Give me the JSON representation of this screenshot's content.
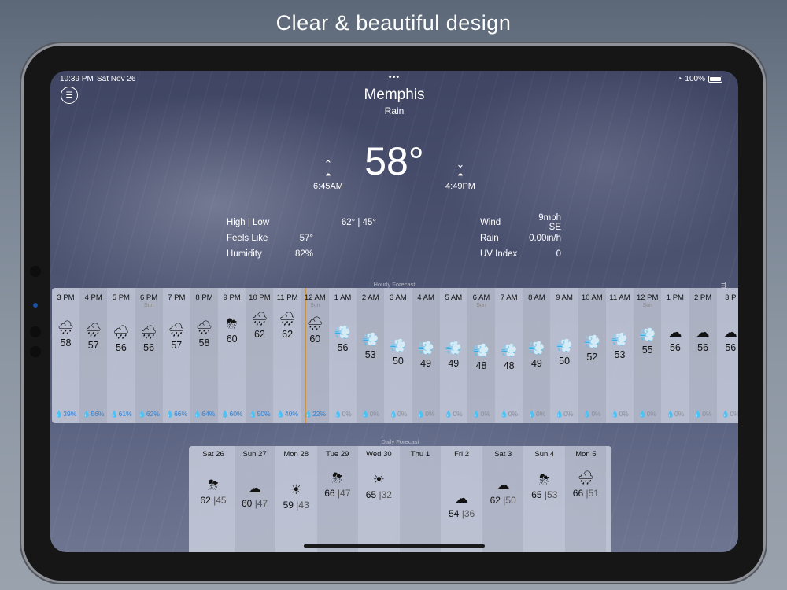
{
  "promo": {
    "title": "Clear & beautiful design"
  },
  "status": {
    "time": "10:39 PM",
    "date": "Sat Nov 26",
    "battery": "100%"
  },
  "current": {
    "city": "Memphis",
    "condition": "Rain",
    "temperature": "58°",
    "sunrise": "6:45AM",
    "sunset": "4:49PM"
  },
  "stats_left": [
    {
      "label": "High | Low",
      "value": "62° | 45°"
    },
    {
      "label": "Feels Like",
      "value": "57°"
    },
    {
      "label": "Humidity",
      "value": "82%"
    }
  ],
  "stats_right": [
    {
      "label": "Wind",
      "value": "9mph SE"
    },
    {
      "label": "Rain",
      "value": "0.00in/h"
    },
    {
      "label": "UV Index",
      "value": "0"
    }
  ],
  "hourly_title": "Hourly Forecast",
  "daily_title": "Daily Forecast",
  "icons": {
    "rain": "🌧",
    "storm": "⛈",
    "wind": "💨",
    "cloud": "☁",
    "partly-cloudy": "🌥",
    "sun": "☀"
  },
  "hourly": [
    {
      "hour": "3 PM",
      "sub": "",
      "icon": "rain",
      "temp": "58",
      "precip": "39%"
    },
    {
      "hour": "4 PM",
      "sub": "",
      "icon": "rain",
      "temp": "57",
      "precip": "56%"
    },
    {
      "hour": "5 PM",
      "sub": "",
      "icon": "rain",
      "temp": "56",
      "precip": "61%"
    },
    {
      "hour": "6 PM",
      "sub": "Sun",
      "icon": "rain",
      "temp": "56",
      "precip": "62%"
    },
    {
      "hour": "7 PM",
      "sub": "",
      "icon": "rain",
      "temp": "57",
      "precip": "66%"
    },
    {
      "hour": "8 PM",
      "sub": "",
      "icon": "rain",
      "temp": "58",
      "precip": "64%"
    },
    {
      "hour": "9 PM",
      "sub": "",
      "icon": "storm",
      "temp": "60",
      "precip": "60%"
    },
    {
      "hour": "10 PM",
      "sub": "",
      "icon": "rain",
      "temp": "62",
      "precip": "50%"
    },
    {
      "hour": "11 PM",
      "sub": "",
      "icon": "rain",
      "temp": "62",
      "precip": "40%"
    },
    {
      "hour": "12 AM",
      "sub": "Sun",
      "icon": "rain",
      "temp": "60",
      "precip": "22%"
    },
    {
      "hour": "1 AM",
      "sub": "",
      "icon": "wind",
      "temp": "56",
      "precip": "0%"
    },
    {
      "hour": "2 AM",
      "sub": "",
      "icon": "wind",
      "temp": "53",
      "precip": "0%"
    },
    {
      "hour": "3 AM",
      "sub": "",
      "icon": "wind",
      "temp": "50",
      "precip": "0%"
    },
    {
      "hour": "4 AM",
      "sub": "",
      "icon": "wind",
      "temp": "49",
      "precip": "0%"
    },
    {
      "hour": "5 AM",
      "sub": "",
      "icon": "wind",
      "temp": "49",
      "precip": "0%"
    },
    {
      "hour": "6 AM",
      "sub": "Sun",
      "icon": "wind",
      "temp": "48",
      "precip": "0%"
    },
    {
      "hour": "7 AM",
      "sub": "",
      "icon": "wind",
      "temp": "48",
      "precip": "0%"
    },
    {
      "hour": "8 AM",
      "sub": "",
      "icon": "wind",
      "temp": "49",
      "precip": "0%"
    },
    {
      "hour": "9 AM",
      "sub": "",
      "icon": "wind",
      "temp": "50",
      "precip": "0%"
    },
    {
      "hour": "10 AM",
      "sub": "",
      "icon": "wind",
      "temp": "52",
      "precip": "0%"
    },
    {
      "hour": "11 AM",
      "sub": "",
      "icon": "wind",
      "temp": "53",
      "precip": "0%"
    },
    {
      "hour": "12 PM",
      "sub": "Sun",
      "icon": "wind",
      "temp": "55",
      "precip": "0%"
    },
    {
      "hour": "1 PM",
      "sub": "",
      "icon": "cloud",
      "temp": "56",
      "precip": "0%"
    },
    {
      "hour": "2 PM",
      "sub": "",
      "icon": "cloud",
      "temp": "56",
      "precip": "0%"
    },
    {
      "hour": "3 P",
      "sub": "",
      "icon": "cloud",
      "temp": "56",
      "precip": "0%"
    }
  ],
  "daily": [
    {
      "day": "Sat 26",
      "icon": "storm",
      "high": "62",
      "low": "45"
    },
    {
      "day": "Sun 27",
      "icon": "cloud",
      "high": "60",
      "low": "47"
    },
    {
      "day": "Mon 28",
      "icon": "sun",
      "high": "59",
      "low": "43"
    },
    {
      "day": "Tue 29",
      "icon": "storm",
      "high": "66",
      "low": "47"
    },
    {
      "day": "Wed 30",
      "icon": "sun",
      "high": "65",
      "low": "32"
    },
    {
      "day": "Thu 1",
      "icon": "cloud",
      "high": "",
      "low": ""
    },
    {
      "day": "Fri 2",
      "icon": "cloud",
      "high": "54",
      "low": "36"
    },
    {
      "day": "Sat 3",
      "icon": "cloud",
      "high": "62",
      "low": "50"
    },
    {
      "day": "Sun 4",
      "icon": "storm",
      "high": "65",
      "low": "53"
    },
    {
      "day": "Mon 5",
      "icon": "rain",
      "high": "66",
      "low": "51"
    }
  ]
}
